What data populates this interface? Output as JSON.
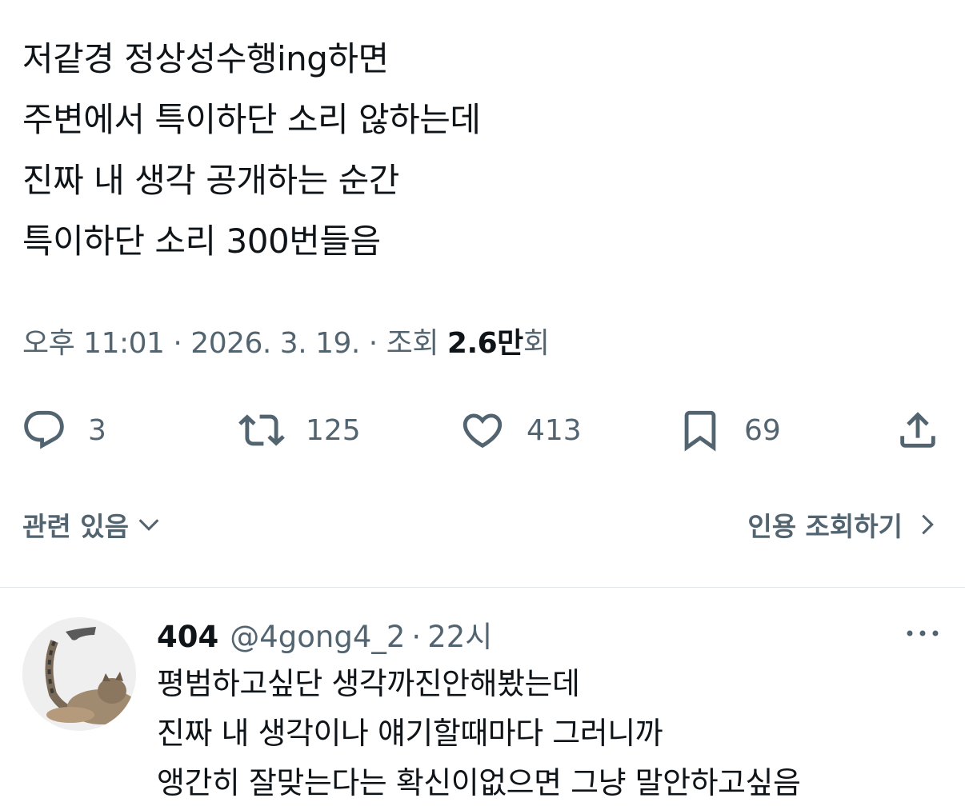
{
  "tweet": {
    "lines": [
      "저같경 정상성수행ing하면",
      "주변에서 특이하단 소리 않하는데",
      "진짜 내 생각 공개하는 순간",
      "특이하단 소리 300번들음"
    ],
    "time": "오후 11:01",
    "dot": "·",
    "date": "2026. 3. 19.",
    "views_label": "조회",
    "views_count": "2.6만",
    "views_suffix": "회"
  },
  "actions": {
    "reply": {
      "icon": "reply-icon",
      "count": "3"
    },
    "retweet": {
      "icon": "retweet-icon",
      "count": "125"
    },
    "like": {
      "icon": "heart-icon",
      "count": "413"
    },
    "bookmark": {
      "icon": "bookmark-icon",
      "count": "69"
    },
    "share": {
      "icon": "share-icon"
    }
  },
  "related": {
    "label": "관련 있음"
  },
  "quotes": {
    "label": "인용 조회하기"
  },
  "reply": {
    "name": "404",
    "handle": "@4gong4_2",
    "dot": "·",
    "time": "22시",
    "lines": [
      "평범하고싶단 생각까진안해봤는데",
      "진짜 내 생각이나 얘기할때마다 그러니까",
      "앵간히 잘맞는다는 확신이없으면 그냥 말안하고싶음"
    ]
  },
  "colors": {
    "text": "#0f1419",
    "secondary": "#536471",
    "divider": "#e3e6e8"
  }
}
